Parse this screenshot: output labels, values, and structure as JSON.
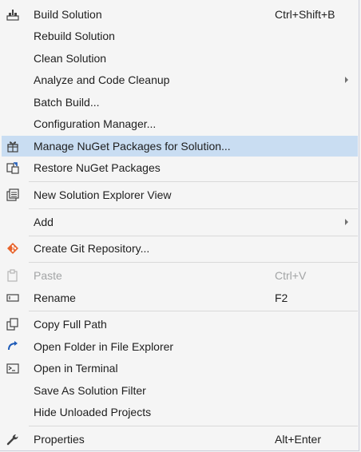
{
  "menu": {
    "build_solution": {
      "label": "Build Solution",
      "shortcut": "Ctrl+Shift+B"
    },
    "rebuild_solution": {
      "label": "Rebuild Solution"
    },
    "clean_solution": {
      "label": "Clean Solution"
    },
    "analyze": {
      "label": "Analyze and Code Cleanup"
    },
    "batch_build": {
      "label": "Batch Build..."
    },
    "config_manager": {
      "label": "Configuration Manager..."
    },
    "manage_nuget": {
      "label": "Manage NuGet Packages for Solution..."
    },
    "restore_nuget": {
      "label": "Restore NuGet Packages"
    },
    "new_explorer_view": {
      "label": "New Solution Explorer View"
    },
    "add": {
      "label": "Add"
    },
    "create_git": {
      "label": "Create Git Repository..."
    },
    "paste": {
      "label": "Paste",
      "shortcut": "Ctrl+V"
    },
    "rename": {
      "label": "Rename",
      "shortcut": "F2"
    },
    "copy_full_path": {
      "label": "Copy Full Path"
    },
    "open_folder": {
      "label": "Open Folder in File Explorer"
    },
    "open_terminal": {
      "label": "Open in Terminal"
    },
    "save_filter": {
      "label": "Save As Solution Filter"
    },
    "hide_unloaded": {
      "label": "Hide Unloaded Projects"
    },
    "properties": {
      "label": "Properties",
      "shortcut": "Alt+Enter"
    }
  },
  "icons": {
    "build": "build-icon",
    "nuget": "nuget-package-icon",
    "restore": "restore-icon",
    "explorer_view": "solution-explorer-icon",
    "git": "git-icon",
    "paste": "paste-icon",
    "rename": "rename-icon",
    "copy": "copy-icon",
    "open_folder": "open-folder-arrow-icon",
    "terminal": "terminal-icon",
    "properties": "wrench-icon"
  },
  "colors": {
    "highlight": "#c9ddf2",
    "background": "#f5f5f5",
    "disabled_text": "#a2a4a5",
    "accent_blue": "#1e5bb8",
    "git_orange": "#e8632b"
  }
}
